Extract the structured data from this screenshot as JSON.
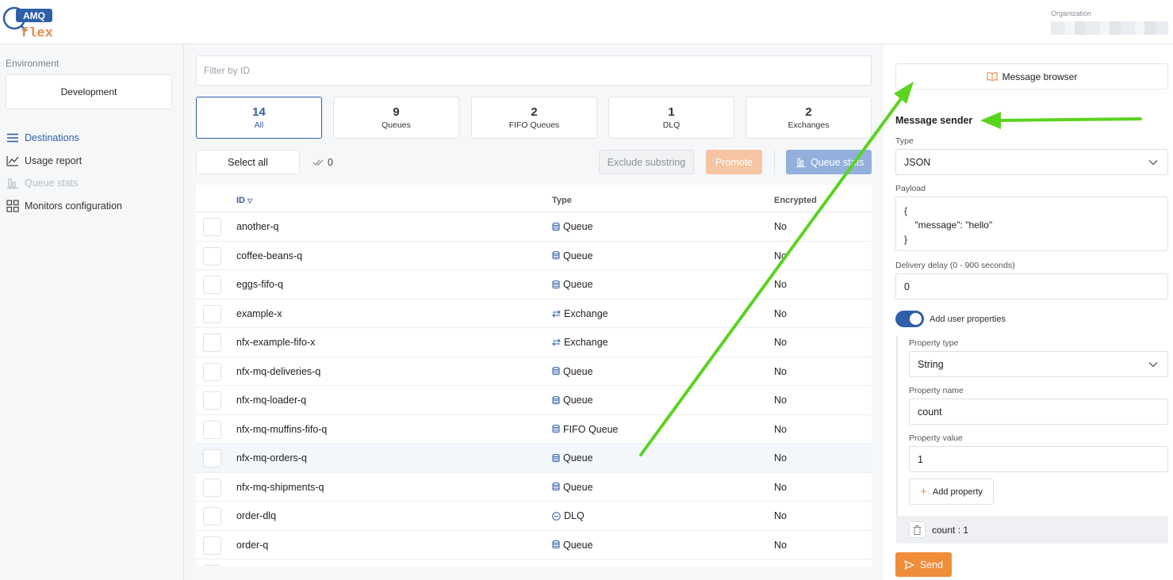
{
  "header": {
    "logo_top": "AMQ",
    "logo_bottom": "flex",
    "org_label": "Organization"
  },
  "sidebar": {
    "env_label": "Environment",
    "env_value": "Development",
    "items": [
      {
        "label": "Destinations",
        "icon": "list-icon"
      },
      {
        "label": "Usage report",
        "icon": "chart-line-icon"
      },
      {
        "label": "Queue stats",
        "icon": "bar-chart-icon"
      },
      {
        "label": "Monitors configuration",
        "icon": "grid-icon"
      }
    ]
  },
  "main": {
    "filter_placeholder": "Filter by ID",
    "cards": [
      {
        "count": "14",
        "label": "All"
      },
      {
        "count": "9",
        "label": "Queues"
      },
      {
        "count": "2",
        "label": "FIFO Queues"
      },
      {
        "count": "1",
        "label": "DLQ"
      },
      {
        "count": "2",
        "label": "Exchanges"
      }
    ],
    "select_all": "Select all",
    "selected_count": "0",
    "exclude_substring": "Exclude substring",
    "promote": "Promote",
    "queue_stats": "Queue stats",
    "columns": {
      "id": "ID",
      "type": "Type",
      "encrypted": "Encrypted"
    },
    "rows": [
      {
        "id": "another-q",
        "type": "Queue",
        "encrypted": "No"
      },
      {
        "id": "coffee-beans-q",
        "type": "Queue",
        "encrypted": "No"
      },
      {
        "id": "eggs-fifo-q",
        "type": "Queue",
        "encrypted": "No"
      },
      {
        "id": "example-x",
        "type": "Exchange",
        "encrypted": "No"
      },
      {
        "id": "nfx-example-fifo-x",
        "type": "Exchange",
        "encrypted": "No"
      },
      {
        "id": "nfx-mq-deliveries-q",
        "type": "Queue",
        "encrypted": "No"
      },
      {
        "id": "nfx-mq-loader-q",
        "type": "Queue",
        "encrypted": "No"
      },
      {
        "id": "nfx-mq-muffins-fifo-q",
        "type": "FIFO Queue",
        "encrypted": "No"
      },
      {
        "id": "nfx-mq-orders-q",
        "type": "Queue",
        "encrypted": "No"
      },
      {
        "id": "nfx-mq-shipments-q",
        "type": "Queue",
        "encrypted": "No"
      },
      {
        "id": "order-dlq",
        "type": "DLQ",
        "encrypted": "No"
      },
      {
        "id": "order-q",
        "type": "Queue",
        "encrypted": "No"
      }
    ]
  },
  "panel": {
    "message_browser": "Message browser",
    "sender_title": "Message sender",
    "type_label": "Type",
    "type_value": "JSON",
    "payload_label": "Payload",
    "payload_value": "{\n    \"message\": \"hello\"\n}",
    "delay_label": "Delivery delay (0 - 900 seconds)",
    "delay_value": "0",
    "user_props_label": "Add user properties",
    "user_props_enabled": true,
    "prop_type_label": "Property type",
    "prop_type_value": "String",
    "prop_name_label": "Property name",
    "prop_name_value": "count",
    "prop_value_label": "Property value",
    "prop_value_value": "1",
    "add_property": "Add property",
    "property_entry": "count : 1",
    "send": "Send"
  },
  "colors": {
    "primary": "#2f5fa8",
    "accent_orange": "#f08d3b",
    "annotation_arrow": "#5ad321"
  }
}
